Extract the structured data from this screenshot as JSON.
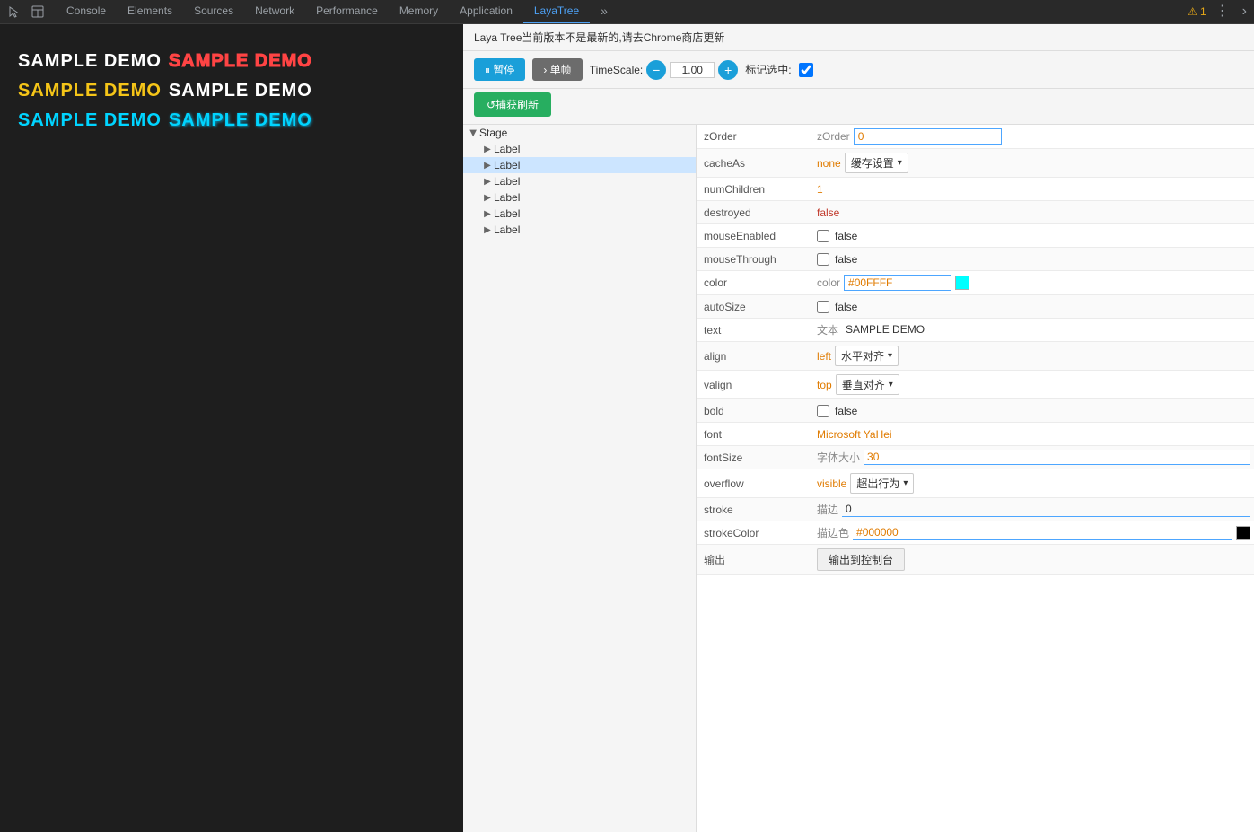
{
  "toolbar": {
    "icon1": "cursor-icon",
    "icon2": "dock-icon",
    "tabs": [
      {
        "label": "Console",
        "active": false
      },
      {
        "label": "Elements",
        "active": false
      },
      {
        "label": "Sources",
        "active": false
      },
      {
        "label": "Network",
        "active": false
      },
      {
        "label": "Performance",
        "active": false
      },
      {
        "label": "Memory",
        "active": false
      },
      {
        "label": "Application",
        "active": false
      },
      {
        "label": "LayaTree",
        "active": true
      }
    ],
    "warning_count": "1",
    "more": "⋮",
    "forward": "›"
  },
  "notice": {
    "text": "Laya Tree当前版本不是最新的,请去Chrome商店更新"
  },
  "controls": {
    "pause_label": "⏸ 暂停",
    "step_label": "› 单帧",
    "timescale_label": "TimeScale:",
    "minus": "−",
    "value": "1.00",
    "plus": "+",
    "mark_label": "标记选中:",
    "capture_label": "↺捕获刷新"
  },
  "tree": {
    "stage": "Stage",
    "items": [
      {
        "label": "Label",
        "selected": false,
        "indent": 1
      },
      {
        "label": "Label",
        "selected": true,
        "indent": 1
      },
      {
        "label": "Label",
        "selected": false,
        "indent": 1
      },
      {
        "label": "Label",
        "selected": false,
        "indent": 1
      },
      {
        "label": "Label",
        "selected": false,
        "indent": 1
      },
      {
        "label": "Label",
        "selected": false,
        "indent": 1
      }
    ]
  },
  "properties": [
    {
      "name": "zOrder",
      "tag": "zOrder",
      "input": "0",
      "type": "input"
    },
    {
      "name": "cacheAs",
      "tag": "none",
      "dropdown": "缓存设置",
      "type": "select"
    },
    {
      "name": "numChildren",
      "value": "1",
      "type": "orange"
    },
    {
      "name": "destroyed",
      "value": "false",
      "type": "red"
    },
    {
      "name": "mouseEnabled",
      "checkbox": false,
      "value": "false",
      "type": "checkbox"
    },
    {
      "name": "mouseThrough",
      "checkbox": false,
      "value": "false",
      "type": "checkbox"
    },
    {
      "name": "color",
      "tag": "color",
      "input": "#00FFFF",
      "swatch": "#00FFFF",
      "type": "color"
    },
    {
      "name": "autoSize",
      "checkbox": false,
      "value": "false",
      "type": "checkbox"
    },
    {
      "name": "text",
      "tag": "文本",
      "input": "SAMPLE DEMO",
      "type": "text-input"
    },
    {
      "name": "align",
      "value": "left",
      "dropdown": "水平对齐",
      "type": "align"
    },
    {
      "name": "valign",
      "value": "top",
      "dropdown": "垂直对齐",
      "type": "align"
    },
    {
      "name": "bold",
      "checkbox": false,
      "value": "false",
      "type": "checkbox"
    },
    {
      "name": "font",
      "value": "Microsoft YaHei",
      "type": "font"
    },
    {
      "name": "fontSize",
      "tag": "字体大小",
      "input": "30",
      "type": "fontsize"
    },
    {
      "name": "overflow",
      "value": "visible",
      "dropdown": "超出行为",
      "type": "align"
    },
    {
      "name": "stroke",
      "tag": "描边",
      "input": "0",
      "type": "stroke-input"
    },
    {
      "name": "strokeColor",
      "tag": "描边色",
      "input": "#000000",
      "swatch": "#000000",
      "type": "strokecolor"
    },
    {
      "name": "输出",
      "btn": "输出到控制台",
      "type": "output"
    }
  ],
  "canvas": {
    "rows": [
      [
        {
          "text": "SAMPLE DEMO",
          "color": "white",
          "style": "normal"
        },
        {
          "text": "SAMPLE DEMO",
          "color": "#ff4444",
          "style": "border"
        }
      ],
      [
        {
          "text": "SAMPLE DEMO",
          "color": "#f5c518",
          "style": "bold"
        },
        {
          "text": "SAMPLE DEMO",
          "color": "white",
          "style": "bold"
        }
      ],
      [
        {
          "text": "SAMPLE DEMO",
          "color": "#00d4ff",
          "style": "bold"
        },
        {
          "text": "SAMPLE DEMO",
          "color": "#00d4ff",
          "style": "bold-shadow"
        }
      ]
    ]
  }
}
